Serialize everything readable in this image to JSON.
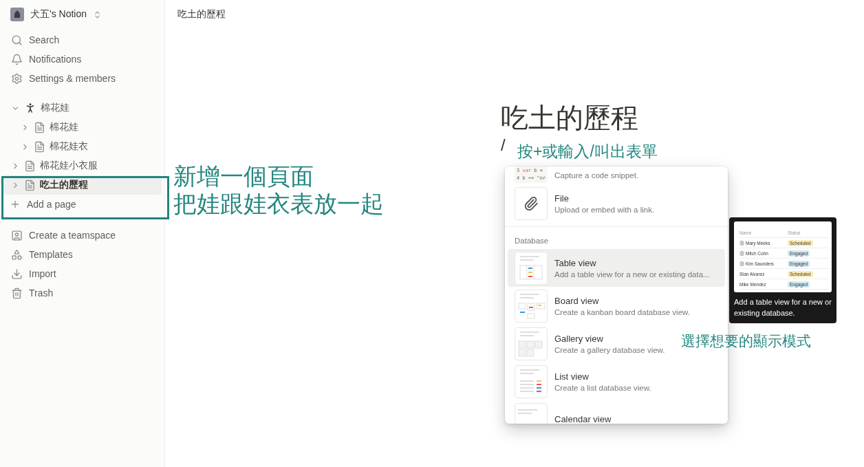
{
  "workspace": {
    "name": "犬五's Notion"
  },
  "sidebar": {
    "nav": [
      {
        "kind": "search",
        "label": "Search"
      },
      {
        "kind": "notifications",
        "label": "Notifications"
      },
      {
        "kind": "settings",
        "label": "Settings & members"
      }
    ],
    "pages": [
      {
        "kind": "person",
        "label": "棉花娃",
        "expanded": true,
        "selected": false,
        "children": [
          {
            "kind": "doc",
            "label": "棉花娃",
            "expanded": false,
            "selected": false
          },
          {
            "kind": "doc",
            "label": "棉花娃衣",
            "expanded": false,
            "selected": false
          }
        ]
      },
      {
        "kind": "doc",
        "label": "棉花娃小衣服",
        "expanded": false,
        "selected": false
      },
      {
        "kind": "doc",
        "label": "吃土的歷程",
        "expanded": false,
        "selected": true
      }
    ],
    "add_page": "Add a page",
    "bottom": [
      {
        "kind": "teamspace",
        "label": "Create a teamspace"
      },
      {
        "kind": "templates",
        "label": "Templates"
      },
      {
        "kind": "import",
        "label": "Import"
      },
      {
        "kind": "trash",
        "label": "Trash"
      }
    ]
  },
  "breadcrumb": "吃土的歷程",
  "page": {
    "title": "吃土的歷程",
    "input": "/"
  },
  "menu": {
    "groups": [
      {
        "items": [
          {
            "kind": "code",
            "description": "Capture a code snippet.",
            "selected": false,
            "code_lines": [
              {
                "number": "3",
                "keyword": "var",
                "code": "b ="
              },
              {
                "number": "4",
                "code": "b += \"or"
              }
            ]
          },
          {
            "kind": "file",
            "title": "File",
            "description": "Upload or embed with a link.",
            "selected": false
          }
        ]
      },
      {
        "header": "Database",
        "items": [
          {
            "kind": "table",
            "title": "Table view",
            "description": "Add a table view for a new or existing data...",
            "selected": true
          },
          {
            "kind": "board",
            "title": "Board view",
            "description": "Create a kanban board database view.",
            "selected": false
          },
          {
            "kind": "gallery",
            "title": "Gallery view",
            "description": "Create a gallery database view.",
            "selected": false
          },
          {
            "kind": "list",
            "title": "List view",
            "description": "Create a list database view.",
            "selected": false
          },
          {
            "kind": "calendar",
            "title": "Calendar view",
            "selected": false
          }
        ]
      }
    ]
  },
  "tooltip": {
    "preview": {
      "columns": [
        "Name",
        "Status"
      ],
      "rows": [
        {
          "kind": "page",
          "name": "Mary Meeks",
          "status": "Scheduled",
          "color": "#fbecb8"
        },
        {
          "kind": "page",
          "name": "Mitch Cohn",
          "status": "Engaged",
          "color": "#cfe8f3"
        },
        {
          "kind": "page",
          "name": "Kim Saunders",
          "status": "Engaged",
          "color": "#cfe8f3"
        },
        {
          "kind": "plain",
          "name": "Stan Alvarez",
          "status": "Scheduled",
          "color": "#fbecb8"
        },
        {
          "kind": "plain",
          "name": "Mike Mendez",
          "status": "Engaged",
          "color": "#cfe8f3"
        }
      ]
    },
    "text": "Add a table view for a new or existing database."
  },
  "annotations": [
    {
      "kind": "sidebar",
      "lines": [
        "新增一個頁面",
        "把娃跟娃衣表放一起"
      ]
    },
    {
      "kind": "title",
      "lines": [
        "按+或輸入/叫出表單"
      ]
    },
    {
      "kind": "menu",
      "lines": [
        "選擇想要的顯示模式"
      ]
    }
  ]
}
